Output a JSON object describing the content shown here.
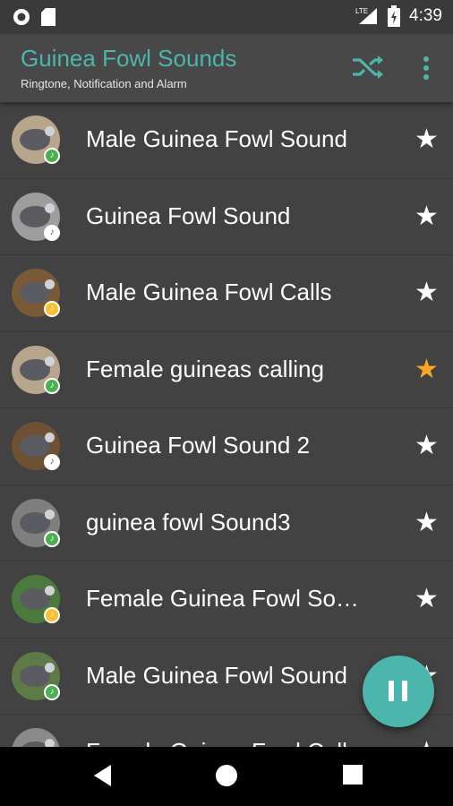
{
  "status_bar": {
    "network": "LTE",
    "time": "4:39"
  },
  "app_bar": {
    "title": "Guinea Fowl Sounds",
    "subtitle": "Ringtone, Notification and Alarm",
    "shuffle_icon": "shuffle-icon",
    "menu_icon": "more-vert-icon"
  },
  "colors": {
    "accent": "#4db6ac",
    "favorite": "#f9a825",
    "background": "#424242",
    "app_bar": "#484848"
  },
  "sounds": [
    {
      "title": "Male Guinea Fowl Sound",
      "favorite": false,
      "badge": "green",
      "avatar": "#b7a68c"
    },
    {
      "title": "Guinea Fowl Sound",
      "favorite": false,
      "badge": "white",
      "avatar": "#9d9d9d"
    },
    {
      "title": "Male Guinea Fowl Calls",
      "favorite": false,
      "badge": "yellow",
      "avatar": "#7a5a36"
    },
    {
      "title": "Female guineas calling",
      "favorite": true,
      "badge": "green",
      "avatar": "#b7a68c"
    },
    {
      "title": "Guinea Fowl Sound 2",
      "favorite": false,
      "badge": "white",
      "avatar": "#6e5133"
    },
    {
      "title": "guinea fowl Sound3",
      "favorite": false,
      "badge": "green",
      "avatar": "#7f7f7f"
    },
    {
      "title": "Female Guinea Fowl Sound",
      "favorite": false,
      "badge": "yellow",
      "avatar": "#4c7a3e"
    },
    {
      "title": "Male Guinea Fowl Sound",
      "favorite": false,
      "badge": "green",
      "avatar": "#5d7a47"
    },
    {
      "title": "Female Guinea Fowl Call",
      "favorite": false,
      "badge": "white",
      "avatar": "#8a8a8a"
    }
  ],
  "fab": {
    "icon": "pause-icon"
  },
  "nav": {
    "back_icon": "back-icon",
    "home_icon": "home-icon",
    "recents_icon": "recents-icon"
  }
}
